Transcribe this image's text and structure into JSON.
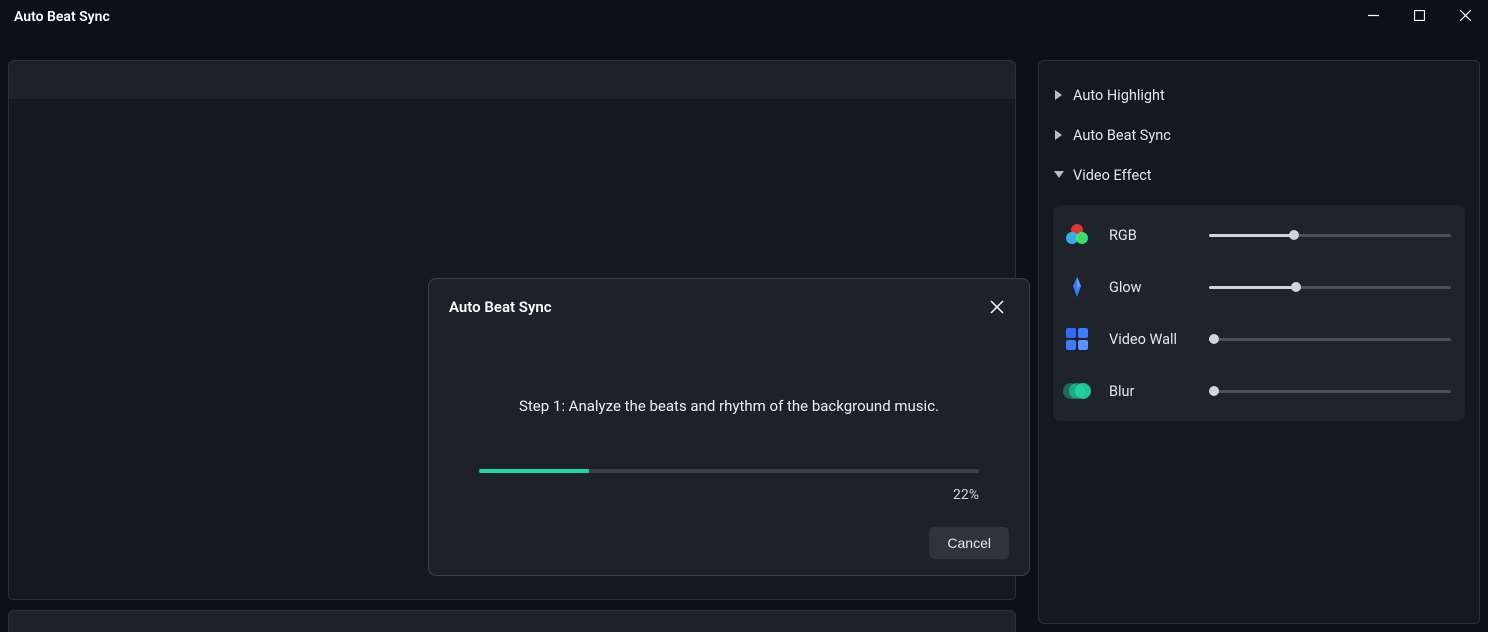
{
  "window": {
    "title": "Auto Beat Sync"
  },
  "sidebar": {
    "items": [
      {
        "label": "Auto Highlight",
        "expanded": false
      },
      {
        "label": "Auto Beat Sync",
        "expanded": false
      },
      {
        "label": "Video Effect",
        "expanded": true
      }
    ],
    "effects": [
      {
        "name": "RGB",
        "icon": "rgb",
        "value": 35
      },
      {
        "name": "Glow",
        "icon": "glow",
        "value": 36
      },
      {
        "name": "Video Wall",
        "icon": "videowall",
        "value": 2
      },
      {
        "name": "Blur",
        "icon": "blur",
        "value": 2
      }
    ]
  },
  "modal": {
    "title": "Auto Beat Sync",
    "step_text": "Step 1: Analyze the beats and rhythm of the background music.",
    "progress_pct": 22,
    "progress_label": "22%",
    "cancel_label": "Cancel"
  }
}
